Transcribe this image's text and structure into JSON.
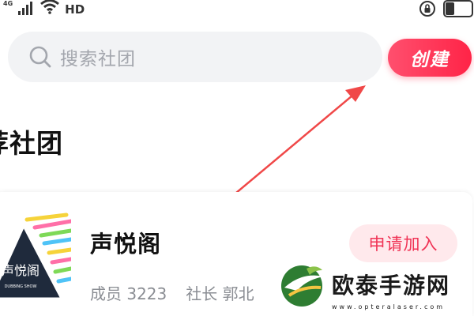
{
  "status_bar": {
    "network": "4G",
    "hd": "HD",
    "icons": [
      "signal-icon",
      "wifi-icon",
      "lock-rotation-icon",
      "battery-icon"
    ]
  },
  "search": {
    "placeholder": "搜索社团"
  },
  "create_button": {
    "label": "创建"
  },
  "section": {
    "title": "荐社团"
  },
  "club": {
    "name": "声悦阁",
    "logo_text": "声悦阁",
    "logo_subtext": "DUBBING SHOW",
    "members": "成员 3223",
    "leader": "社长 郭北",
    "join_label": "申请加入"
  },
  "watermark": {
    "title": "欧泰手游网",
    "url": "www.opteralaser.com"
  },
  "colors": {
    "accent": "#ff2d4f",
    "join_bg": "#ffe9ec",
    "search_bg": "#f2f3f5",
    "arrow": "#f04848"
  }
}
